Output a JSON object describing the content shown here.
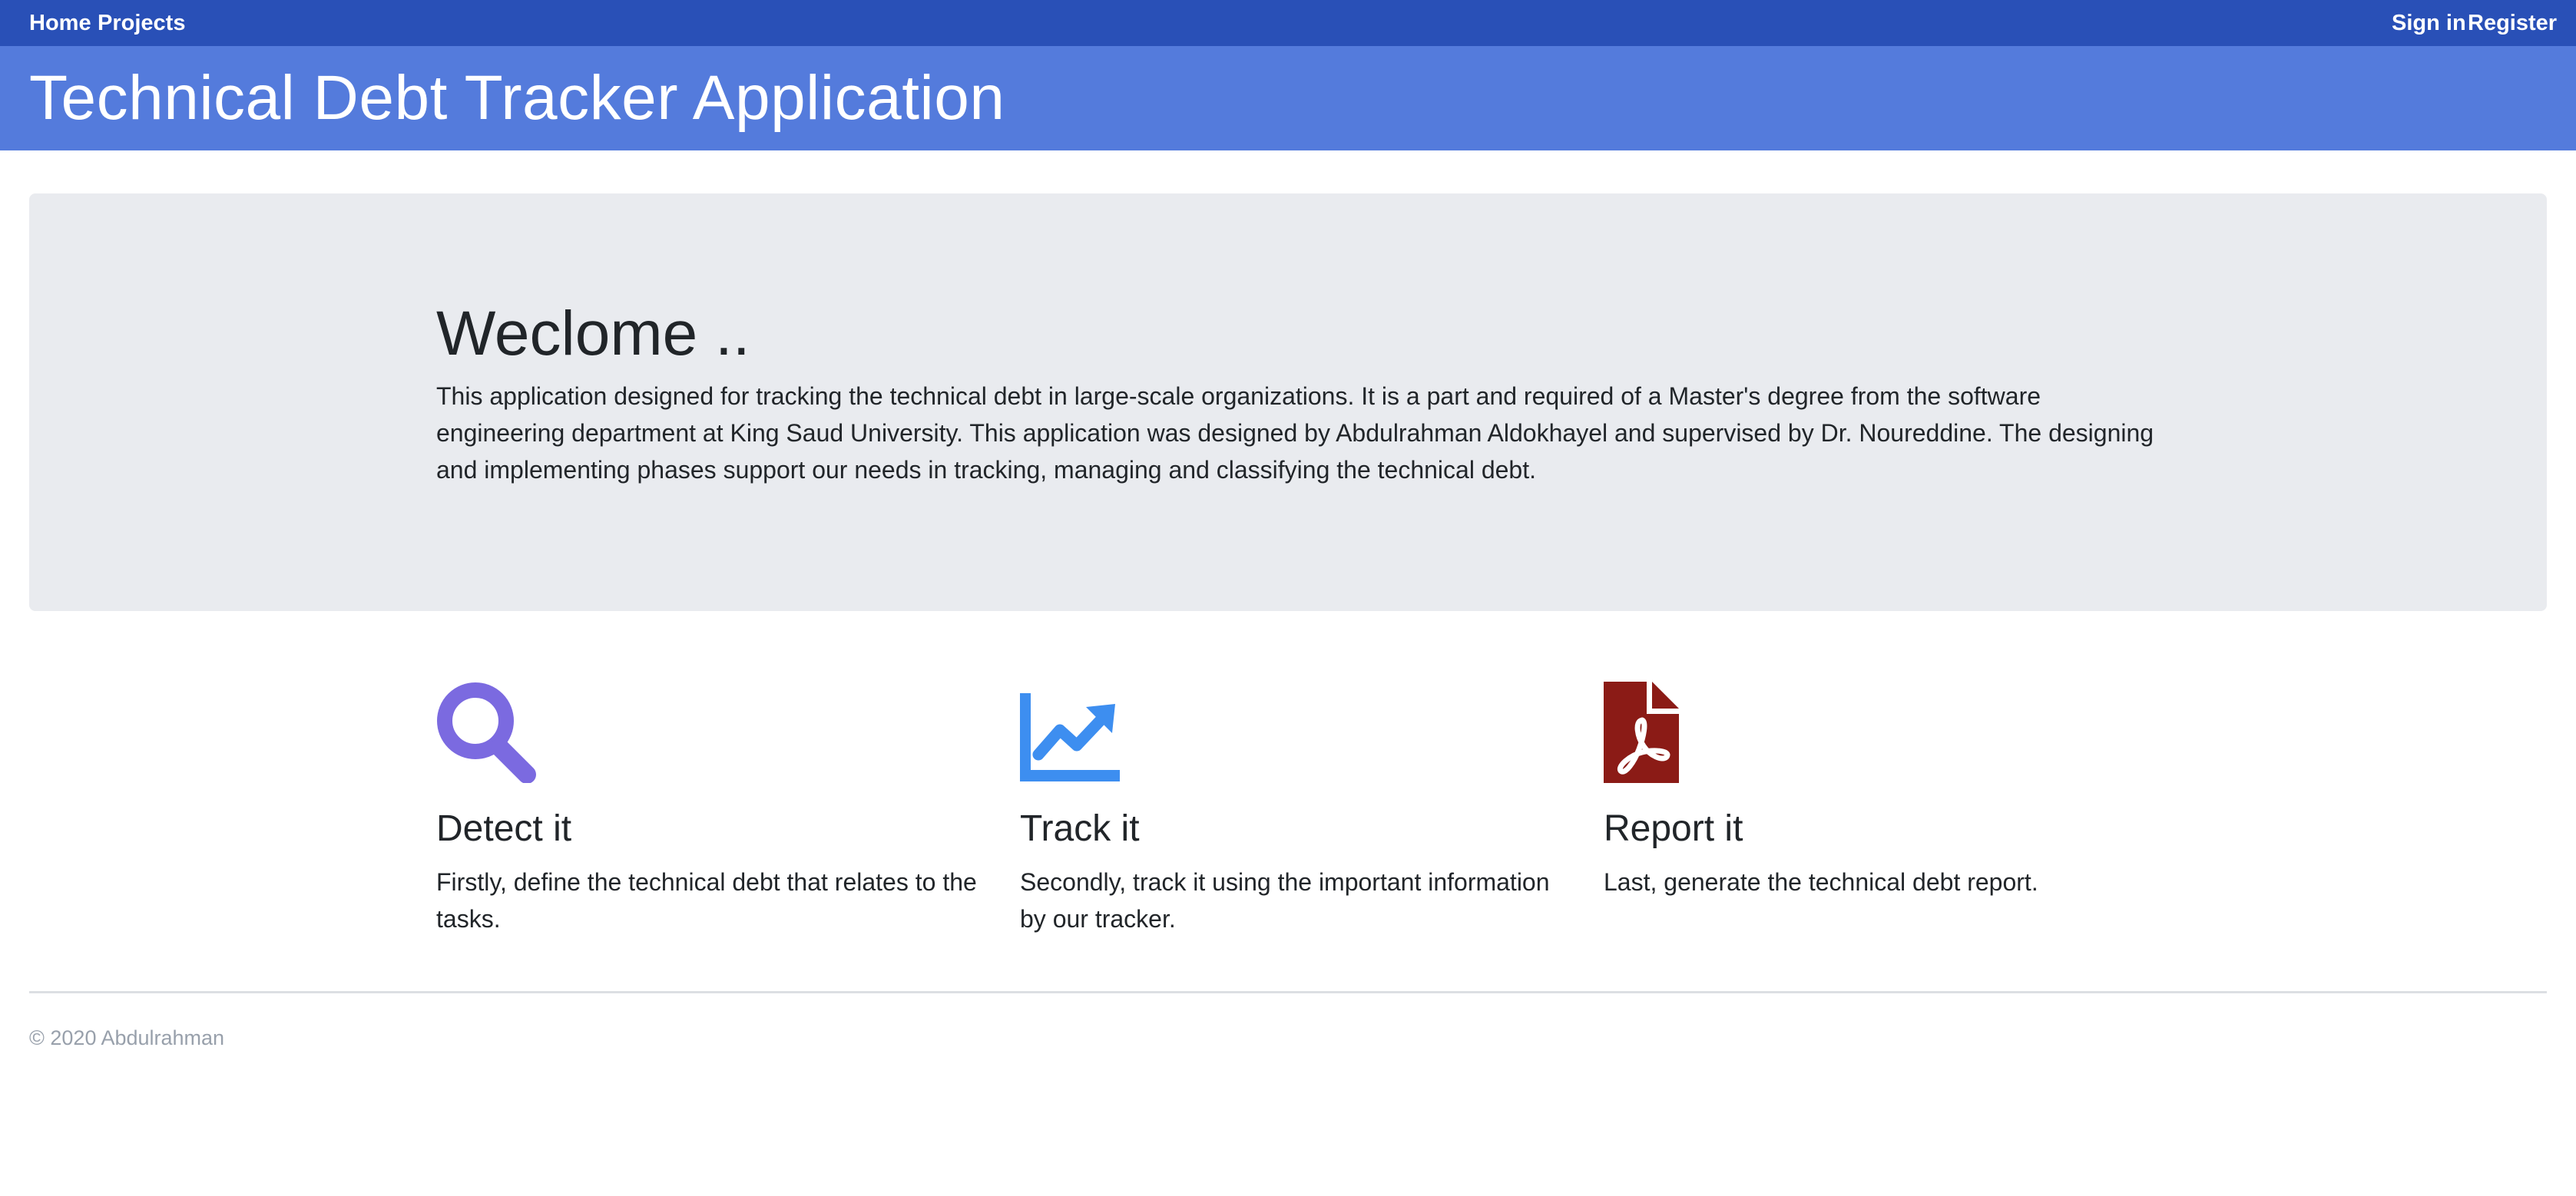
{
  "nav": {
    "home": "Home",
    "projects": "Projects",
    "sign_in": "Sign in",
    "register": "Register"
  },
  "header": {
    "title": "Technical Debt Tracker Application"
  },
  "jumbotron": {
    "heading": "Weclome ..",
    "text": "This application designed for tracking the technical debt in large-scale organizations. It is a part and required of a Master's degree from the software engineering department at King Saud University. This application was designed by Abdulrahman Aldokhayel and supervised by Dr. Noureddine. The designing and implementing phases support our needs in tracking, managing and classifying the technical debt."
  },
  "features": [
    {
      "icon": "search-icon",
      "color": "#7b6ae0",
      "title": "Detect it",
      "text": "Firstly, define the technical debt that relates to the tasks."
    },
    {
      "icon": "chart-line-icon",
      "color": "#3d8ef0",
      "title": "Track it",
      "text": "Secondly, track it using the important information by our tracker."
    },
    {
      "icon": "pdf-file-icon",
      "color": "#8b1b16",
      "title": "Report it",
      "text": "Last, generate the technical debt report."
    }
  ],
  "footer": {
    "text": "© 2020 Abdulrahman"
  },
  "colors": {
    "nav_bg": "#2950b7",
    "header_bg": "#547bdc",
    "jumbotron_bg": "#e9ebef"
  }
}
